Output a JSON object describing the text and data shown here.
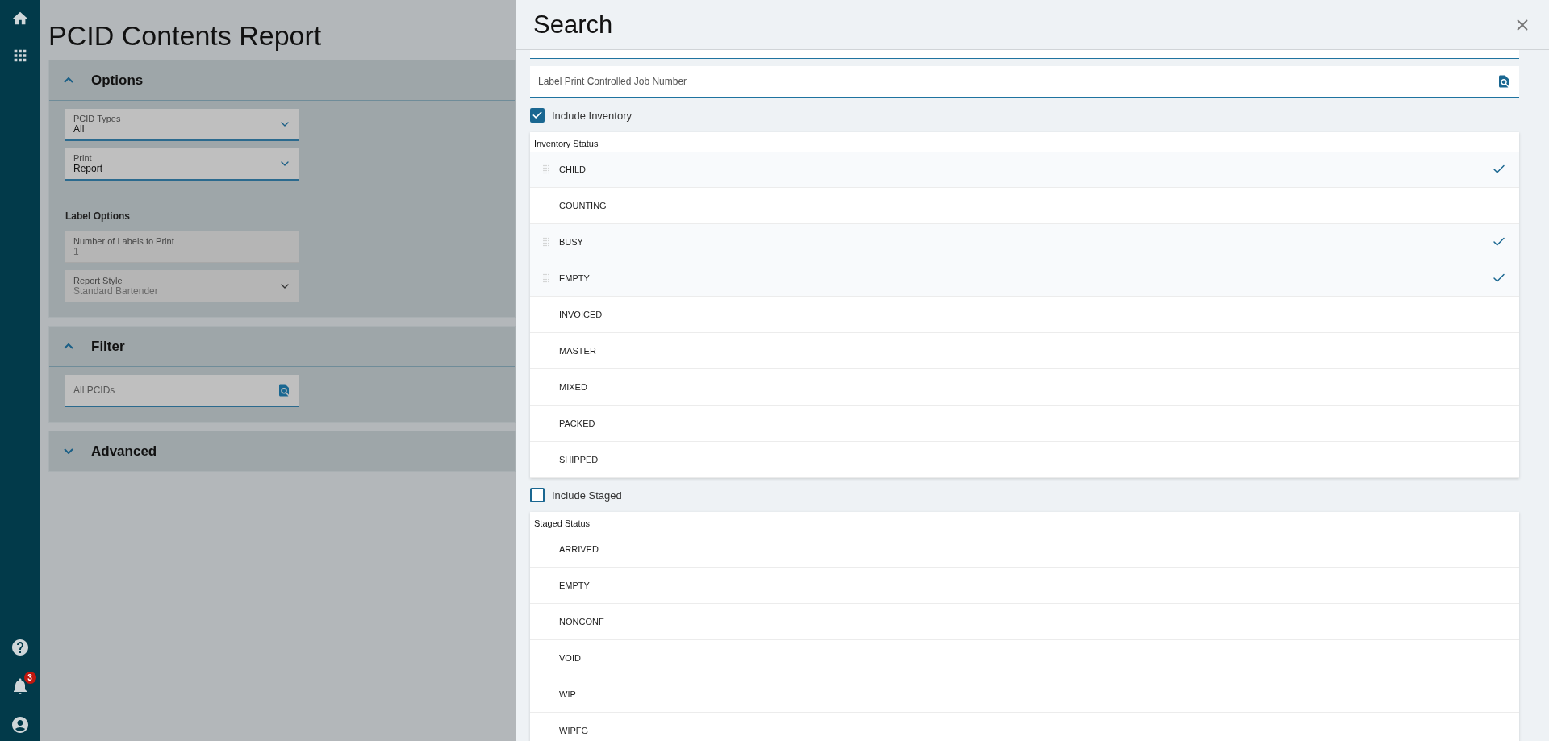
{
  "sidebar": {
    "notification_count": "3"
  },
  "page": {
    "title": "PCID Contents Report",
    "sections": [
      {
        "title": "Options",
        "expanded": true,
        "items": [
          {
            "kind": "dropdown",
            "label": "PCID Types",
            "value": "All",
            "disabled": false
          },
          {
            "kind": "dropdown",
            "label": "Print",
            "value": "Report",
            "disabled": false
          },
          {
            "kind": "heading",
            "label": "Label Options"
          },
          {
            "kind": "text",
            "label": "Number of Labels to Print",
            "value": "1",
            "disabled": true
          },
          {
            "kind": "dropdown",
            "label": "Report Style",
            "value": "Standard Bartender",
            "disabled": true
          }
        ]
      },
      {
        "title": "Filter",
        "expanded": true,
        "items": [
          {
            "kind": "lookup",
            "placeholder": "All PCIDs",
            "disabled": false
          }
        ]
      },
      {
        "title": "Advanced",
        "expanded": false
      }
    ]
  },
  "drawer": {
    "title": "Search",
    "lookup": {
      "placeholder": "Label Print Controlled Job Number"
    },
    "groups": [
      {
        "checkbox_label": "Include Inventory",
        "checked": true,
        "list_title": "Inventory Status",
        "items": [
          {
            "label": "CHILD",
            "selected": true
          },
          {
            "label": "COUNTING",
            "selected": false
          },
          {
            "label": "BUSY",
            "selected": true
          },
          {
            "label": "EMPTY",
            "selected": true
          },
          {
            "label": "INVOICED",
            "selected": false
          },
          {
            "label": "MASTER",
            "selected": false
          },
          {
            "label": "MIXED",
            "selected": false
          },
          {
            "label": "PACKED",
            "selected": false
          },
          {
            "label": "SHIPPED",
            "selected": false
          }
        ]
      },
      {
        "checkbox_label": "Include Staged",
        "checked": false,
        "list_title": "Staged Status",
        "items": [
          {
            "label": "ARRIVED",
            "selected": false
          },
          {
            "label": "EMPTY",
            "selected": false
          },
          {
            "label": "NONCONF",
            "selected": false
          },
          {
            "label": "VOID",
            "selected": false
          },
          {
            "label": "WIP",
            "selected": false
          },
          {
            "label": "WIPFG",
            "selected": false
          }
        ]
      }
    ]
  }
}
